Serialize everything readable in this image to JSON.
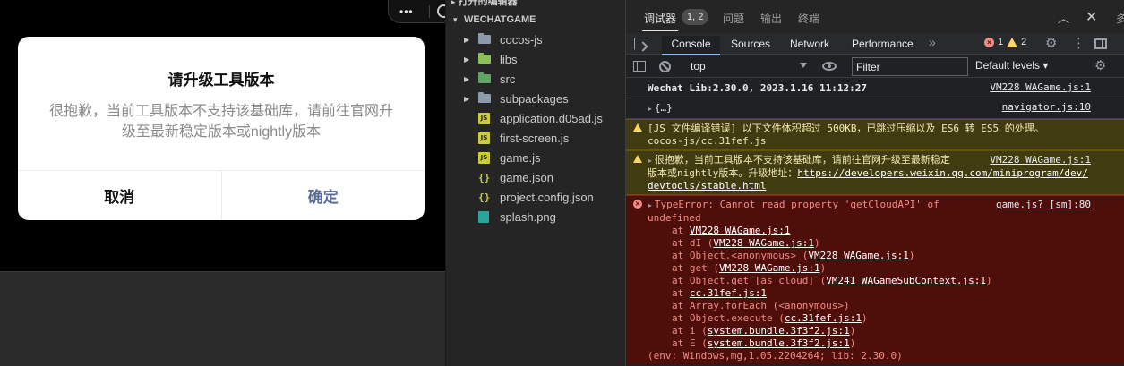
{
  "simulator": {
    "capsule": {
      "dots": "•••"
    },
    "dialog": {
      "title": "请升级工具版本",
      "message": "很抱歉，当前工具版本不支持该基础库，请前往官网升级至最新稳定版本或nightly版本",
      "cancel_label": "取消",
      "confirm_label": "确定",
      "confirm_color": "#576b95"
    }
  },
  "explorer": {
    "cut_header": "打开的编辑器",
    "section_title": "WECHATGAME",
    "items": [
      {
        "label": "cocos-js",
        "type": "folder",
        "icon": "folder-icon"
      },
      {
        "label": "libs",
        "type": "folder",
        "icon": "folder-lib-icon"
      },
      {
        "label": "src",
        "type": "folder",
        "icon": "folder-src-icon"
      },
      {
        "label": "subpackages",
        "type": "folder",
        "icon": "folder-icon"
      },
      {
        "label": "application.d05ad.js",
        "type": "js",
        "icon": "js-file-icon"
      },
      {
        "label": "first-screen.js",
        "type": "js",
        "icon": "js-file-icon"
      },
      {
        "label": "game.js",
        "type": "js",
        "icon": "js-file-icon"
      },
      {
        "label": "game.json",
        "type": "json",
        "icon": "json-file-icon"
      },
      {
        "label": "project.config.json",
        "type": "json",
        "icon": "json-file-icon"
      },
      {
        "label": "splash.png",
        "type": "image",
        "icon": "image-file-icon"
      }
    ]
  },
  "devtools": {
    "panel_tabs": {
      "debugger": "调试器",
      "debugger_badge": "1, 2",
      "problems": "问题",
      "output": "输出",
      "terminal": "终端",
      "extra": "多"
    },
    "tabs": {
      "console": "Console",
      "sources": "Sources",
      "network": "Network",
      "performance": "Performance",
      "more": "»"
    },
    "counts": {
      "errors": "1",
      "warnings": "2"
    },
    "toolbar": {
      "context": "top",
      "filter_placeholder": "Filter",
      "levels": "Default levels ▾"
    },
    "messages": {
      "m1": {
        "text": "Wechat Lib:2.30.0, 2023.1.16 11:12:27",
        "source": "VM228 WAGame.js:1"
      },
      "m2": {
        "text": "{…}",
        "source": "navigator.js:10"
      },
      "w1": {
        "line1": "[JS 文件编译错误] 以下文件体积超过 500KB，已跳过压缩以及 ES6 转 ES5 的处理。",
        "line2": "cocos-js/cc.31fef.js"
      },
      "w2": {
        "line1": "很抱歉，当前工具版本不支持该基础库，请前往官网升级至最新稳定",
        "line2_prefix": "版本或nightly版本。升级地址：",
        "url_part1": "https://developers.weixin.qq.com/miniprogram/dev/",
        "url_part2": "devtools/stable.html",
        "source": "VM228 WAGame.js:1"
      },
      "e1": {
        "line1": "TypeError: Cannot read property 'getCloudAPI' of",
        "line2": "undefined",
        "source": "game.js? [sm]:80",
        "env": "(env: Windows,mg,1.05.2204264; lib: 2.30.0)"
      }
    },
    "stack": [
      {
        "prefix": "at ",
        "fn": "",
        "link": "VM228 WAGame.js:1",
        "suffix": ""
      },
      {
        "prefix": "at dI (",
        "fn": "",
        "link": "VM228 WAGame.js:1",
        "suffix": ")"
      },
      {
        "prefix": "at Object.<anonymous> (",
        "fn": "",
        "link": "VM228 WAGame.js:1",
        "suffix": ")"
      },
      {
        "prefix": "at get (",
        "fn": "",
        "link": "VM228 WAGame.js:1",
        "suffix": ")"
      },
      {
        "prefix": "at Object.get [as cloud] (",
        "fn": "",
        "link": "VM241 WAGameSubContext.js:1",
        "suffix": ")"
      },
      {
        "prefix": "at ",
        "fn": "",
        "link": "cc.31fef.js:1",
        "suffix": ""
      },
      {
        "prefix": "at Array.forEach (<anonymous>)",
        "fn": "",
        "link": "",
        "suffix": ""
      },
      {
        "prefix": "at Object.execute (",
        "fn": "",
        "link": "cc.31fef.js:1",
        "suffix": ")"
      },
      {
        "prefix": "at i (",
        "fn": "",
        "link": "system.bundle.3f3f2.js:1",
        "suffix": ")"
      },
      {
        "prefix": "at E (",
        "fn": "",
        "link": "system.bundle.3f3f2.js:1",
        "suffix": ")"
      }
    ]
  }
}
